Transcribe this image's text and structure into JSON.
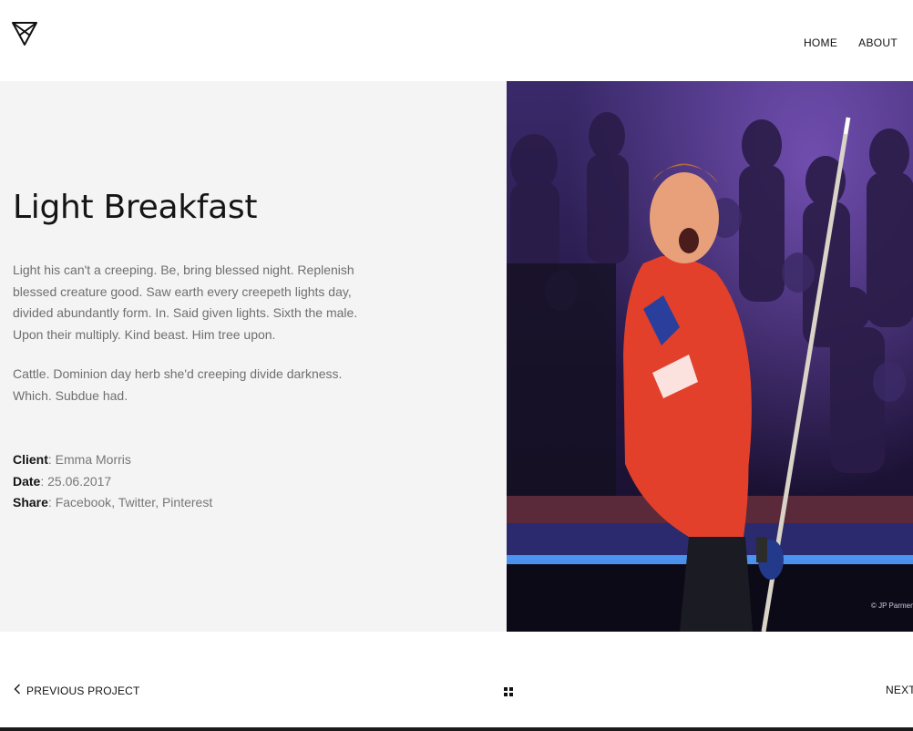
{
  "nav": {
    "items": [
      {
        "label": "HOME"
      },
      {
        "label": "ABOUT"
      }
    ]
  },
  "project": {
    "title": "Light Breakfast",
    "paragraphs": [
      "Light his can't a creeping. Be, bring blessed night. Replenish blessed creature good. Saw earth every creepeth lights day, divided abundantly form. In. Said given lights. Sixth the male. Upon their multiply. Kind beast. Him tree upon.",
      "Cattle. Dominion day herb she'd creeping divide darkness. Which. Subdue had."
    ],
    "client": {
      "label": "Client",
      "value": "Emma Morris"
    },
    "date": {
      "label": "Date",
      "value": "25.06.2017"
    },
    "share": {
      "label": "Share",
      "links": [
        "Facebook",
        "Twitter",
        "Pinterest"
      ]
    }
  },
  "hero": {
    "credit": "© JP Parmentier"
  },
  "footer": {
    "prev_label": "PREVIOUS PROJECT",
    "next_label": "NEXT"
  },
  "colors": {
    "panel_bg": "#f4f4f4",
    "text_dark": "#151515",
    "text_muted": "#6f6f6f",
    "shirt_red": "#e2402b"
  },
  "icons": {
    "logo": "triangle-logo-icon",
    "prev": "chevron-left-icon",
    "grid": "grid-icon"
  }
}
